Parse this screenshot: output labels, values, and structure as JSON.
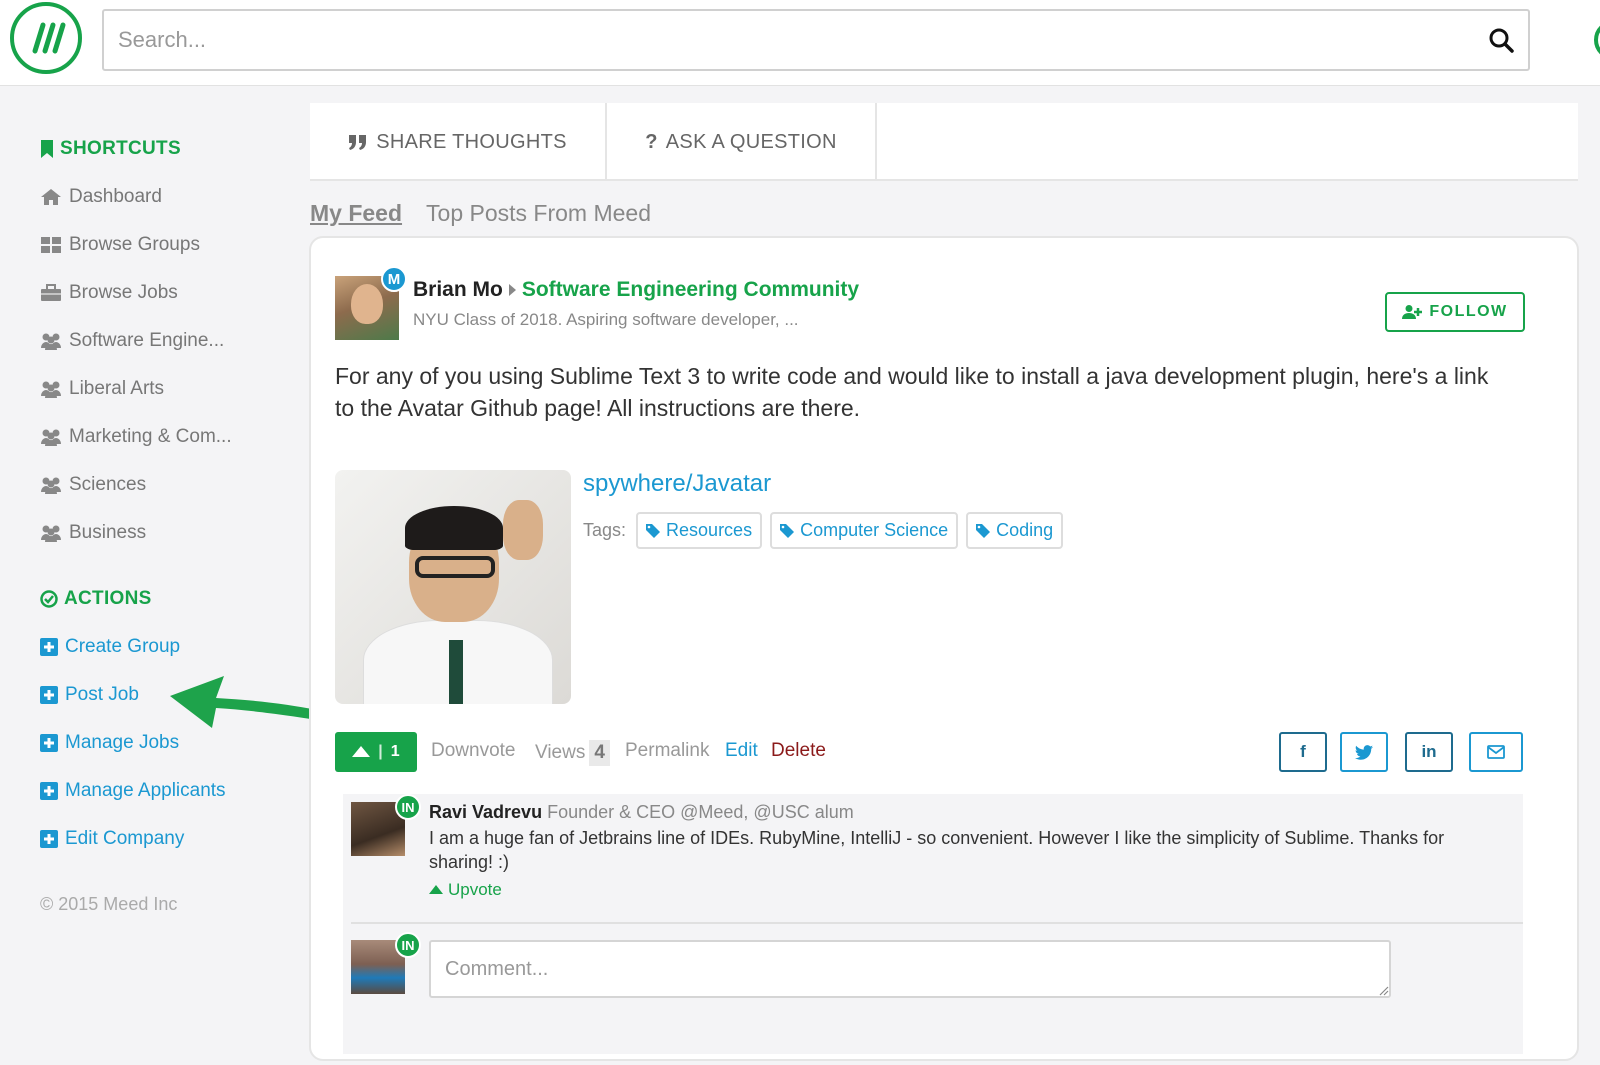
{
  "header": {
    "search_placeholder": "Search...",
    "icons": {
      "logo": "meed-logo-icon",
      "search": "search-icon"
    }
  },
  "sidebar": {
    "shortcuts_heading": "SHORTCUTS",
    "shortcuts": [
      {
        "label": "Dashboard",
        "icon": "home-icon"
      },
      {
        "label": "Browse Groups",
        "icon": "grid-icon"
      },
      {
        "label": "Browse Jobs",
        "icon": "briefcase-icon"
      },
      {
        "label": "Software Engine...",
        "icon": "users-icon"
      },
      {
        "label": "Liberal Arts",
        "icon": "users-icon"
      },
      {
        "label": "Marketing & Com...",
        "icon": "users-icon"
      },
      {
        "label": "Sciences",
        "icon": "users-icon"
      },
      {
        "label": "Business",
        "icon": "users-icon"
      }
    ],
    "actions_heading": "ACTIONS",
    "actions": [
      {
        "label": "Create Group",
        "icon": "plus-square-icon"
      },
      {
        "label": "Post Job",
        "icon": "plus-square-icon"
      },
      {
        "label": "Manage Jobs",
        "icon": "plus-square-icon"
      },
      {
        "label": "Manage Applicants",
        "icon": "plus-square-icon"
      },
      {
        "label": "Edit Company",
        "icon": "plus-square-icon"
      }
    ],
    "copyright": "© 2015 Meed Inc"
  },
  "post_tabs": {
    "share_thoughts": "SHARE THOUGHTS",
    "ask_question": "ASK A QUESTION"
  },
  "feed_tabs": {
    "my_feed": "My Feed",
    "top_posts": "Top Posts From Meed"
  },
  "post": {
    "author_name": "Brian Mo",
    "author_badge": "M",
    "community": "Software Engineering Community",
    "author_subtitle": "NYU Class of 2018. Aspiring software developer, ...",
    "follow_label": "FOLLOW",
    "body": "For any of you using Sublime Text 3 to write code and would like to install a java development plugin, here's a link to the Avatar Github page! All instructions are there.",
    "link_title": "spywhere/Javatar",
    "tags_label": "Tags:",
    "tags": [
      "Resources",
      "Computer Science",
      "Coding"
    ],
    "upvote_count": "1",
    "downvote_label": "Downvote",
    "views_label": "Views",
    "views_count": "4",
    "permalink_label": "Permalink",
    "edit_label": "Edit",
    "delete_label": "Delete",
    "share": {
      "facebook": "f",
      "linkedin": "in"
    }
  },
  "comments": {
    "items": [
      {
        "author": "Ravi Vadrevu",
        "badge": "IN",
        "headline": "Founder & CEO @Meed, @USC alum",
        "text": "I am a huge fan of Jetbrains line of IDEs. RubyMine, IntelliJ - so convenient. However I like the simplicity of Sublime. Thanks for sharing! :)",
        "upvote_label": "Upvote"
      }
    ],
    "input_badge": "IN",
    "input_placeholder": "Comment..."
  },
  "colors": {
    "brand_green": "#17a34a",
    "link_blue": "#1b98d1",
    "delete_red": "#8b1a1a"
  }
}
